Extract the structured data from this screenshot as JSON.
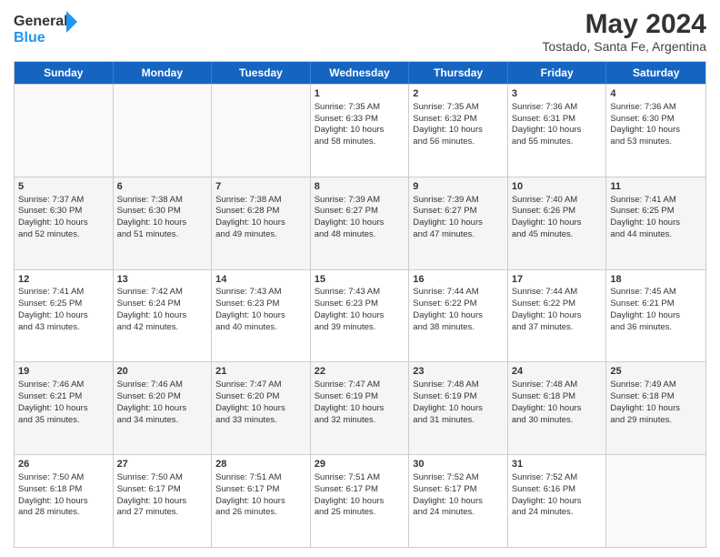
{
  "header": {
    "logo_line1": "General",
    "logo_line2": "Blue",
    "month_title": "May 2024",
    "location": "Tostado, Santa Fe, Argentina"
  },
  "days_of_week": [
    "Sunday",
    "Monday",
    "Tuesday",
    "Wednesday",
    "Thursday",
    "Friday",
    "Saturday"
  ],
  "weeks": [
    [
      {
        "day": "",
        "info": ""
      },
      {
        "day": "",
        "info": ""
      },
      {
        "day": "",
        "info": ""
      },
      {
        "day": "1",
        "info": "Sunrise: 7:35 AM\nSunset: 6:33 PM\nDaylight: 10 hours\nand 58 minutes."
      },
      {
        "day": "2",
        "info": "Sunrise: 7:35 AM\nSunset: 6:32 PM\nDaylight: 10 hours\nand 56 minutes."
      },
      {
        "day": "3",
        "info": "Sunrise: 7:36 AM\nSunset: 6:31 PM\nDaylight: 10 hours\nand 55 minutes."
      },
      {
        "day": "4",
        "info": "Sunrise: 7:36 AM\nSunset: 6:30 PM\nDaylight: 10 hours\nand 53 minutes."
      }
    ],
    [
      {
        "day": "5",
        "info": "Sunrise: 7:37 AM\nSunset: 6:30 PM\nDaylight: 10 hours\nand 52 minutes."
      },
      {
        "day": "6",
        "info": "Sunrise: 7:38 AM\nSunset: 6:30 PM\nDaylight: 10 hours\nand 51 minutes."
      },
      {
        "day": "7",
        "info": "Sunrise: 7:38 AM\nSunset: 6:28 PM\nDaylight: 10 hours\nand 49 minutes."
      },
      {
        "day": "8",
        "info": "Sunrise: 7:39 AM\nSunset: 6:27 PM\nDaylight: 10 hours\nand 48 minutes."
      },
      {
        "day": "9",
        "info": "Sunrise: 7:39 AM\nSunset: 6:27 PM\nDaylight: 10 hours\nand 47 minutes."
      },
      {
        "day": "10",
        "info": "Sunrise: 7:40 AM\nSunset: 6:26 PM\nDaylight: 10 hours\nand 45 minutes."
      },
      {
        "day": "11",
        "info": "Sunrise: 7:41 AM\nSunset: 6:25 PM\nDaylight: 10 hours\nand 44 minutes."
      }
    ],
    [
      {
        "day": "12",
        "info": "Sunrise: 7:41 AM\nSunset: 6:25 PM\nDaylight: 10 hours\nand 43 minutes."
      },
      {
        "day": "13",
        "info": "Sunrise: 7:42 AM\nSunset: 6:24 PM\nDaylight: 10 hours\nand 42 minutes."
      },
      {
        "day": "14",
        "info": "Sunrise: 7:43 AM\nSunset: 6:23 PM\nDaylight: 10 hours\nand 40 minutes."
      },
      {
        "day": "15",
        "info": "Sunrise: 7:43 AM\nSunset: 6:23 PM\nDaylight: 10 hours\nand 39 minutes."
      },
      {
        "day": "16",
        "info": "Sunrise: 7:44 AM\nSunset: 6:22 PM\nDaylight: 10 hours\nand 38 minutes."
      },
      {
        "day": "17",
        "info": "Sunrise: 7:44 AM\nSunset: 6:22 PM\nDaylight: 10 hours\nand 37 minutes."
      },
      {
        "day": "18",
        "info": "Sunrise: 7:45 AM\nSunset: 6:21 PM\nDaylight: 10 hours\nand 36 minutes."
      }
    ],
    [
      {
        "day": "19",
        "info": "Sunrise: 7:46 AM\nSunset: 6:21 PM\nDaylight: 10 hours\nand 35 minutes."
      },
      {
        "day": "20",
        "info": "Sunrise: 7:46 AM\nSunset: 6:20 PM\nDaylight: 10 hours\nand 34 minutes."
      },
      {
        "day": "21",
        "info": "Sunrise: 7:47 AM\nSunset: 6:20 PM\nDaylight: 10 hours\nand 33 minutes."
      },
      {
        "day": "22",
        "info": "Sunrise: 7:47 AM\nSunset: 6:19 PM\nDaylight: 10 hours\nand 32 minutes."
      },
      {
        "day": "23",
        "info": "Sunrise: 7:48 AM\nSunset: 6:19 PM\nDaylight: 10 hours\nand 31 minutes."
      },
      {
        "day": "24",
        "info": "Sunrise: 7:48 AM\nSunset: 6:18 PM\nDaylight: 10 hours\nand 30 minutes."
      },
      {
        "day": "25",
        "info": "Sunrise: 7:49 AM\nSunset: 6:18 PM\nDaylight: 10 hours\nand 29 minutes."
      }
    ],
    [
      {
        "day": "26",
        "info": "Sunrise: 7:50 AM\nSunset: 6:18 PM\nDaylight: 10 hours\nand 28 minutes."
      },
      {
        "day": "27",
        "info": "Sunrise: 7:50 AM\nSunset: 6:17 PM\nDaylight: 10 hours\nand 27 minutes."
      },
      {
        "day": "28",
        "info": "Sunrise: 7:51 AM\nSunset: 6:17 PM\nDaylight: 10 hours\nand 26 minutes."
      },
      {
        "day": "29",
        "info": "Sunrise: 7:51 AM\nSunset: 6:17 PM\nDaylight: 10 hours\nand 25 minutes."
      },
      {
        "day": "30",
        "info": "Sunrise: 7:52 AM\nSunset: 6:17 PM\nDaylight: 10 hours\nand 24 minutes."
      },
      {
        "day": "31",
        "info": "Sunrise: 7:52 AM\nSunset: 6:16 PM\nDaylight: 10 hours\nand 24 minutes."
      },
      {
        "day": "",
        "info": ""
      }
    ]
  ]
}
